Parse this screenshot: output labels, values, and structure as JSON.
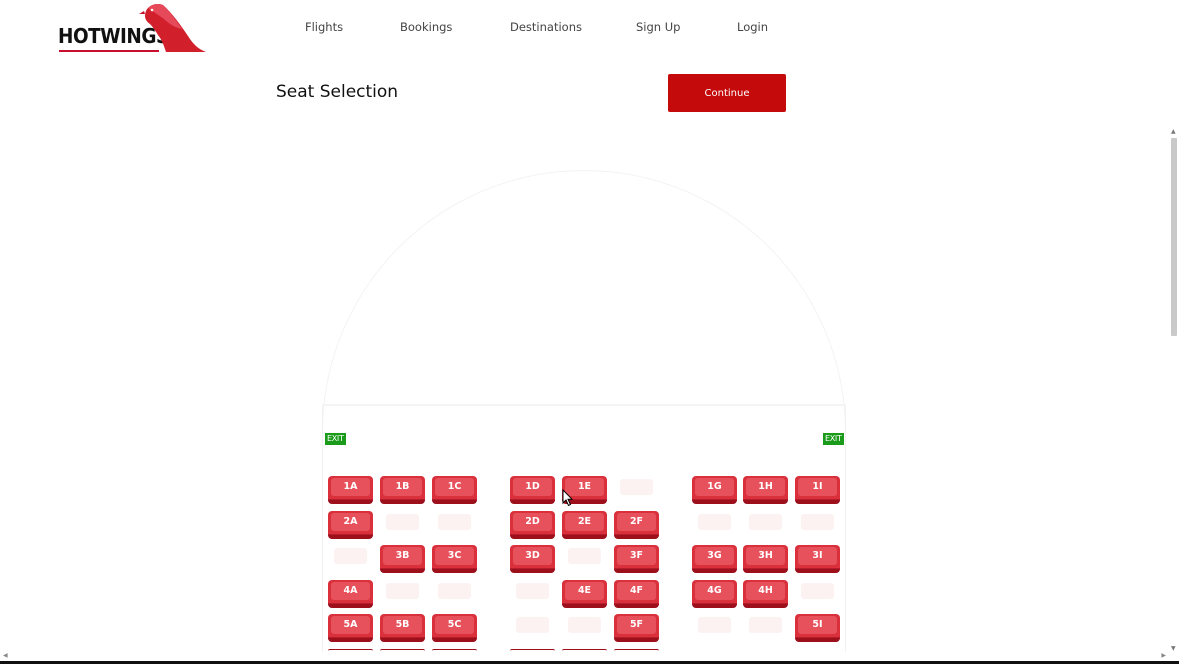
{
  "brand": {
    "name": "HOTWINGS",
    "accent": "#c8102e"
  },
  "nav": {
    "items": [
      "Flights",
      "Bookings",
      "Destinations",
      "Sign Up",
      "Login"
    ]
  },
  "page": {
    "title": "Seat Selection",
    "continue_label": "Continue"
  },
  "exits": {
    "left": "EXIT",
    "right": "EXIT"
  },
  "colors": {
    "seat": "#d9303c",
    "seat_shadow": "#9c0f1b",
    "exit": "#1a9b1a",
    "button": "#c40a0a"
  },
  "seat_columns": [
    "A",
    "B",
    "C",
    "D",
    "E",
    "F",
    "G",
    "H",
    "I"
  ],
  "seat_rows": [
    {
      "row": 1,
      "available": [
        true,
        true,
        true,
        true,
        true,
        false,
        true,
        true,
        true
      ]
    },
    {
      "row": 2,
      "available": [
        true,
        false,
        false,
        true,
        true,
        true,
        false,
        false,
        false
      ]
    },
    {
      "row": 3,
      "available": [
        false,
        true,
        true,
        true,
        false,
        true,
        true,
        true,
        true
      ]
    },
    {
      "row": 4,
      "available": [
        true,
        false,
        false,
        false,
        true,
        true,
        true,
        true,
        false
      ]
    },
    {
      "row": 5,
      "available": [
        true,
        true,
        true,
        false,
        false,
        true,
        false,
        false,
        true
      ]
    }
  ]
}
